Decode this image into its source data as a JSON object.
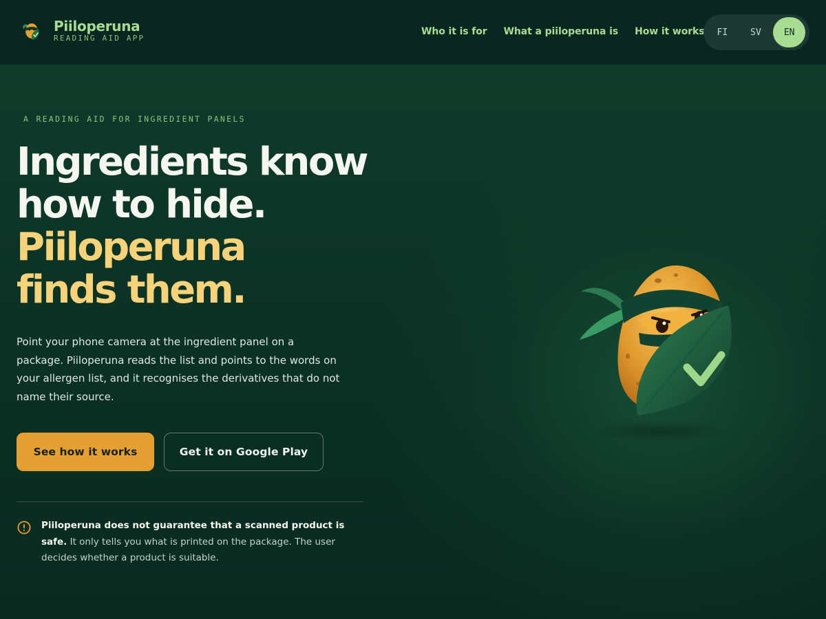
{
  "brand": {
    "name": "Piiloperuna",
    "subtitle": "READING AID APP",
    "logo_icon": "ninja-potato-logo-icon"
  },
  "nav": {
    "links": [
      "Who it is for",
      "What a piiloperuna is",
      "How it works"
    ]
  },
  "languages": {
    "options": [
      "FI",
      "SV",
      "EN"
    ],
    "selected": "EN"
  },
  "hero": {
    "eyebrow": "A READING AID FOR INGREDIENT PANELS",
    "headline_line1": "Ingredients know",
    "headline_line2": "how to hide.",
    "headline_line3": "Piiloperuna",
    "headline_line4": "finds them.",
    "lead": "Point your phone camera at the ingredient panel on a package. Piiloperuna reads the list and points to the words on your allergen list, and it recognises the derivatives that do not name their source.",
    "primary_button": "See how it works",
    "secondary_button": "Get it on Google Play"
  },
  "notice": {
    "icon": "warning-circle-icon",
    "bold": "Piiloperuna does not guarantee that a scanned product is safe.",
    "text": " It only tells you what is printed on the package. The user decides whether a product is suitable."
  },
  "illustration": {
    "icon": "ninja-potato-mascot-icon"
  },
  "colors": {
    "background": "#0b3024",
    "header": "#0a2620",
    "accent_green": "#a7dc92",
    "accent_gold": "#f6d27a",
    "primary_button": "#e5a033"
  }
}
